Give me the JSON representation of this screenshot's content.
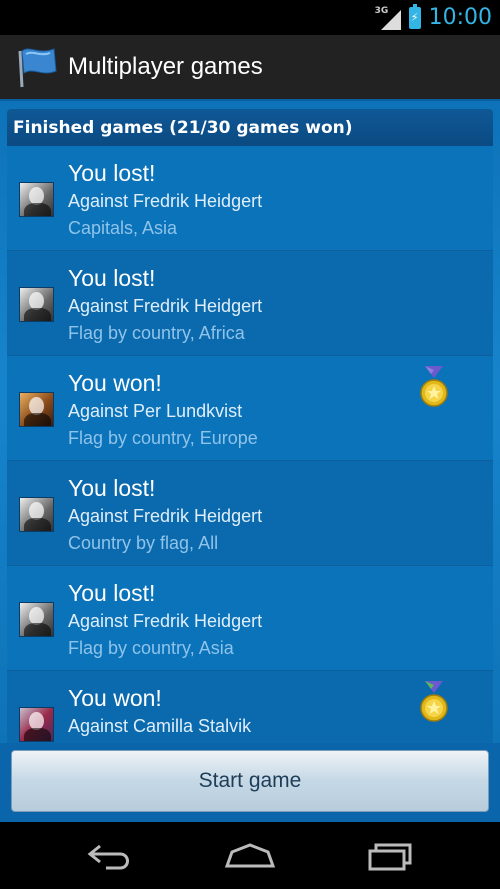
{
  "status_bar": {
    "network_label": "3G",
    "time": "10:00"
  },
  "action_bar": {
    "title": "Multiplayer games",
    "app_icon": "flag-icon"
  },
  "section": {
    "header": "Finished games (21/30 games won)"
  },
  "games": [
    {
      "result": "You lost!",
      "opponent": "Against Fredrik Heidgert",
      "category": "Capitals, Asia",
      "medal": false,
      "avatar": "gray"
    },
    {
      "result": "You lost!",
      "opponent": "Against Fredrik Heidgert",
      "category": "Flag by country, Africa",
      "medal": false,
      "avatar": "gray"
    },
    {
      "result": "You won!",
      "opponent": "Against Per Lundkvist",
      "category": "Flag by country, Europe",
      "medal": true,
      "avatar": "warm"
    },
    {
      "result": "You lost!",
      "opponent": "Against Fredrik Heidgert",
      "category": "Country by flag, All",
      "medal": false,
      "avatar": "gray"
    },
    {
      "result": "You lost!",
      "opponent": "Against Fredrik Heidgert",
      "category": "Flag by country, Asia",
      "medal": false,
      "avatar": "gray"
    },
    {
      "result": "You won!",
      "opponent": "Against Camilla Stalvik",
      "category": "",
      "medal": true,
      "avatar": "red"
    }
  ],
  "start_button": {
    "label": "Start game"
  },
  "colors": {
    "accent": "#33b5e5",
    "list_background": "#0a73ba",
    "header_background": "#0b4a82"
  },
  "nav": {
    "back_icon": "back-icon",
    "home_icon": "home-icon",
    "recents_icon": "recent-apps-icon"
  }
}
